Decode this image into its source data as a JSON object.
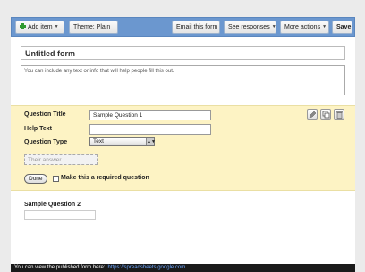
{
  "toolbar": {
    "add_item": "Add item",
    "theme": "Theme:  Plain",
    "email_form": "Email this form",
    "see_responses": "See responses",
    "more_actions": "More actions",
    "save": "Save"
  },
  "form": {
    "title": "Untitled form",
    "description": "You can include any text or info that will help people fill this out."
  },
  "question_editor": {
    "title_label": "Question Title",
    "title_value": "Sample Question 1",
    "help_label": "Help Text",
    "help_value": "",
    "type_label": "Question Type",
    "type_value": "Text",
    "answer_placeholder": "Their answer",
    "done_label": "Done",
    "required_label": "Make this a required question",
    "required_checked": false
  },
  "question2": {
    "title": "Sample Question 2"
  },
  "footer": {
    "text": "You can view the published form here:",
    "link": "https://spreadsheets.google.com"
  },
  "colors": {
    "toolbar": "#6b97cf",
    "editor_bg": "#fdf3c4",
    "footer_bg": "#1a1a1a",
    "link": "#6fa8ff"
  }
}
